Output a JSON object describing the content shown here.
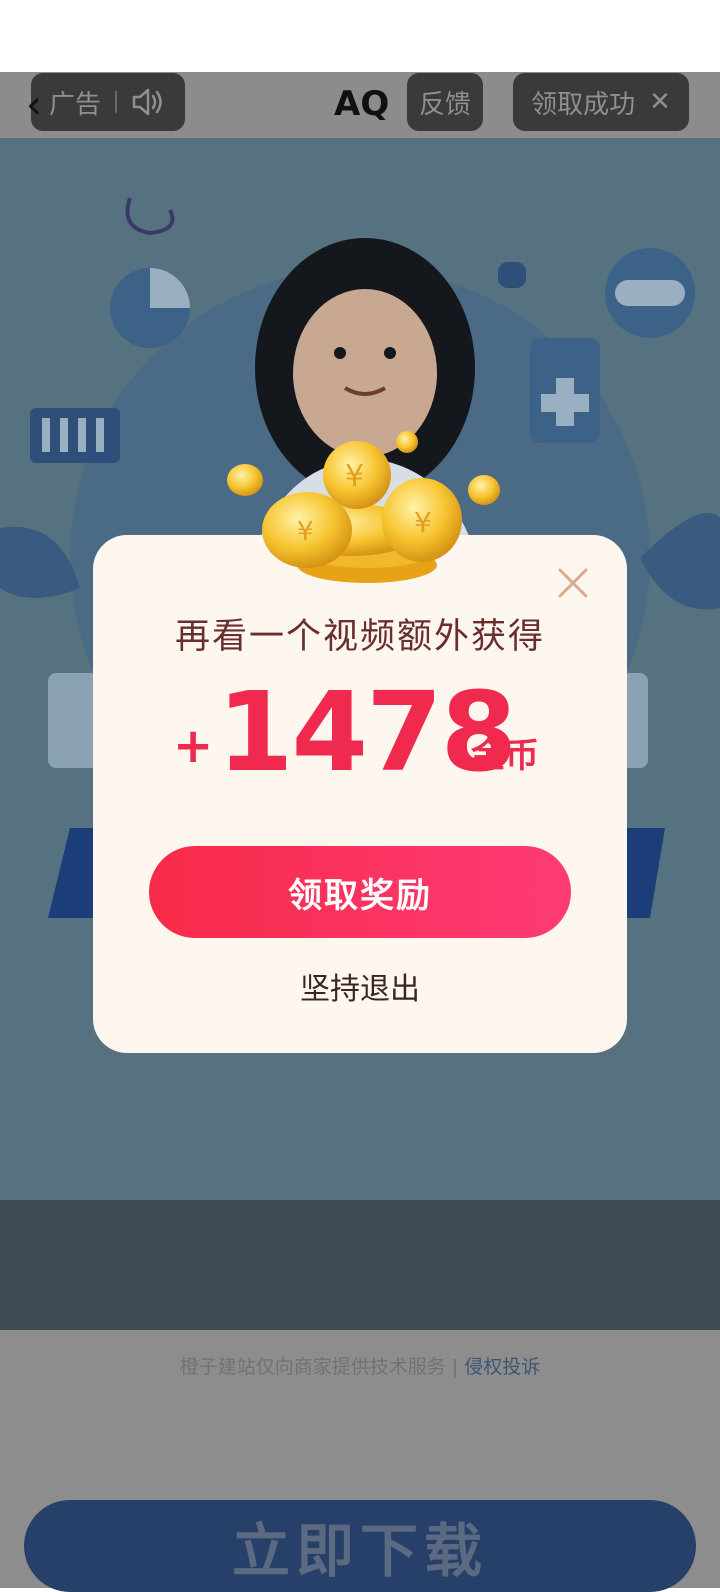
{
  "topbar": {
    "ad_label": "广告",
    "sound_icon": "speaker-icon",
    "brand": "AQ",
    "feedback_label": "反馈",
    "reward_status": "领取成功"
  },
  "modal": {
    "title": "再看一个视频额外获得",
    "amount_prefix": "+",
    "amount": "1478",
    "amount_unit": "金币",
    "claim_label": "领取奖励",
    "quit_label": "坚持退出"
  },
  "footer": {
    "notice": "橙子建站仅向商家提供技术服务 | ",
    "complaint_link": "侵权投诉",
    "download_label": "立即下载"
  },
  "colors": {
    "accent": "#f02a4f",
    "modal_bg": "#fdf7ef",
    "title_text": "#6b2e2e"
  }
}
